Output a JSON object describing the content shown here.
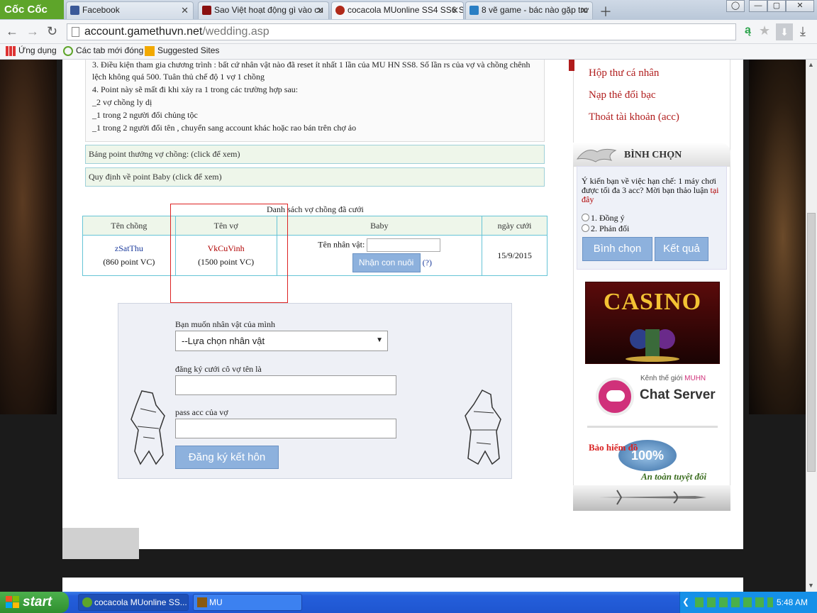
{
  "browser": {
    "logo": "Cốc Cốc",
    "tabs": [
      {
        "label": "Facebook"
      },
      {
        "label": "Sao Việt hoạt động gì vào cu"
      },
      {
        "label": "cocacola MUonline SS4 SS6 S"
      },
      {
        "label": "8 vẽ game - bác nào gặp trư"
      }
    ],
    "url_host": "account.gamethuvn.net",
    "url_path": "/wedding.asp",
    "bookmarks": [
      "Ứng dụng",
      "Các tab mới đóng",
      "Suggested Sites"
    ],
    "translate_icon": "ą"
  },
  "rules": {
    "lines": [
      "3. Điều kiện tham gia chương trình : bất cứ nhân vật nào đã reset ít nhất 1 lần của MU HN SS8. Số lần rs của vợ và chồng chênh",
      "lệch không quá 500. Tuân thủ chế độ 1 vợ 1 chồng",
      "4. Point này sẽ mất đi khi xảy ra 1 trong các trường hợp sau:",
      "_2 vợ chồng ly dị",
      "_1 trong 2 người đổi chủng tộc",
      "_1 trong 2 người đổi tên , chuyển sang account khác hoặc rao bán trên chợ ảo"
    ],
    "bar_bonus": "Bảng point thưởng vợ chồng: (click để xem)",
    "bar_baby": "Quy định về point Baby (click để xem)"
  },
  "couples": {
    "title": "Danh sách vợ chồng đã cưới",
    "headers": [
      "Tên chồng",
      "Tên vợ",
      "Baby",
      "ngày cưới"
    ],
    "row": {
      "husband": "zSatThu",
      "husband_points": "(860 point VC)",
      "wife": "VkCuVinh",
      "wife_points": "(1500 point VC)",
      "baby_label": "Tên nhân vật:",
      "adopt_button": "Nhận con nuôi",
      "help": "(?)",
      "date": "15/9/2015"
    }
  },
  "register": {
    "choose_label": "Bạn muốn nhân vật của mình",
    "choose_select": "--Lựa chọn nhân vật",
    "wife_label": "đăng ký cưới  cô vợ tên là",
    "pass_label": "pass acc của vợ",
    "submit": "Đăng ký kết hôn"
  },
  "sidebar": {
    "links": [
      "Hộp thư cá nhân",
      "Nạp thẻ đổi bạc",
      "Thoát tài khoản (acc)"
    ],
    "vote_title": "BÌNH CHỌN",
    "vote_question": "Ý kiến bạn về việc hạn chế: 1 máy chơi được tối đa 3 acc? Mời bạn thảo luận",
    "vote_here": "tại đây",
    "options": [
      "1. Đồng ý",
      "2. Phản đối"
    ],
    "vote_button": "Bình chọn",
    "result_button": "Kết quả",
    "casino": "CASINO",
    "chat_sub_1": "Kênh thế giới ",
    "chat_sub_2": "MUHN",
    "chat_title": "Chat Server",
    "insurance": "Bảo hiểm đồ",
    "seal": "100%",
    "safe": "An toàn tuyệt đối"
  },
  "taskbar": {
    "start": "start",
    "buttons": [
      "cocacola MUonline SS...",
      "MU"
    ],
    "clock": "5:48 AM"
  },
  "colors": {
    "accent_red": "#b01c1c",
    "button_blue": "#8db1dd",
    "table_border": "#66c4d6",
    "header_green": "#eef6ea"
  }
}
